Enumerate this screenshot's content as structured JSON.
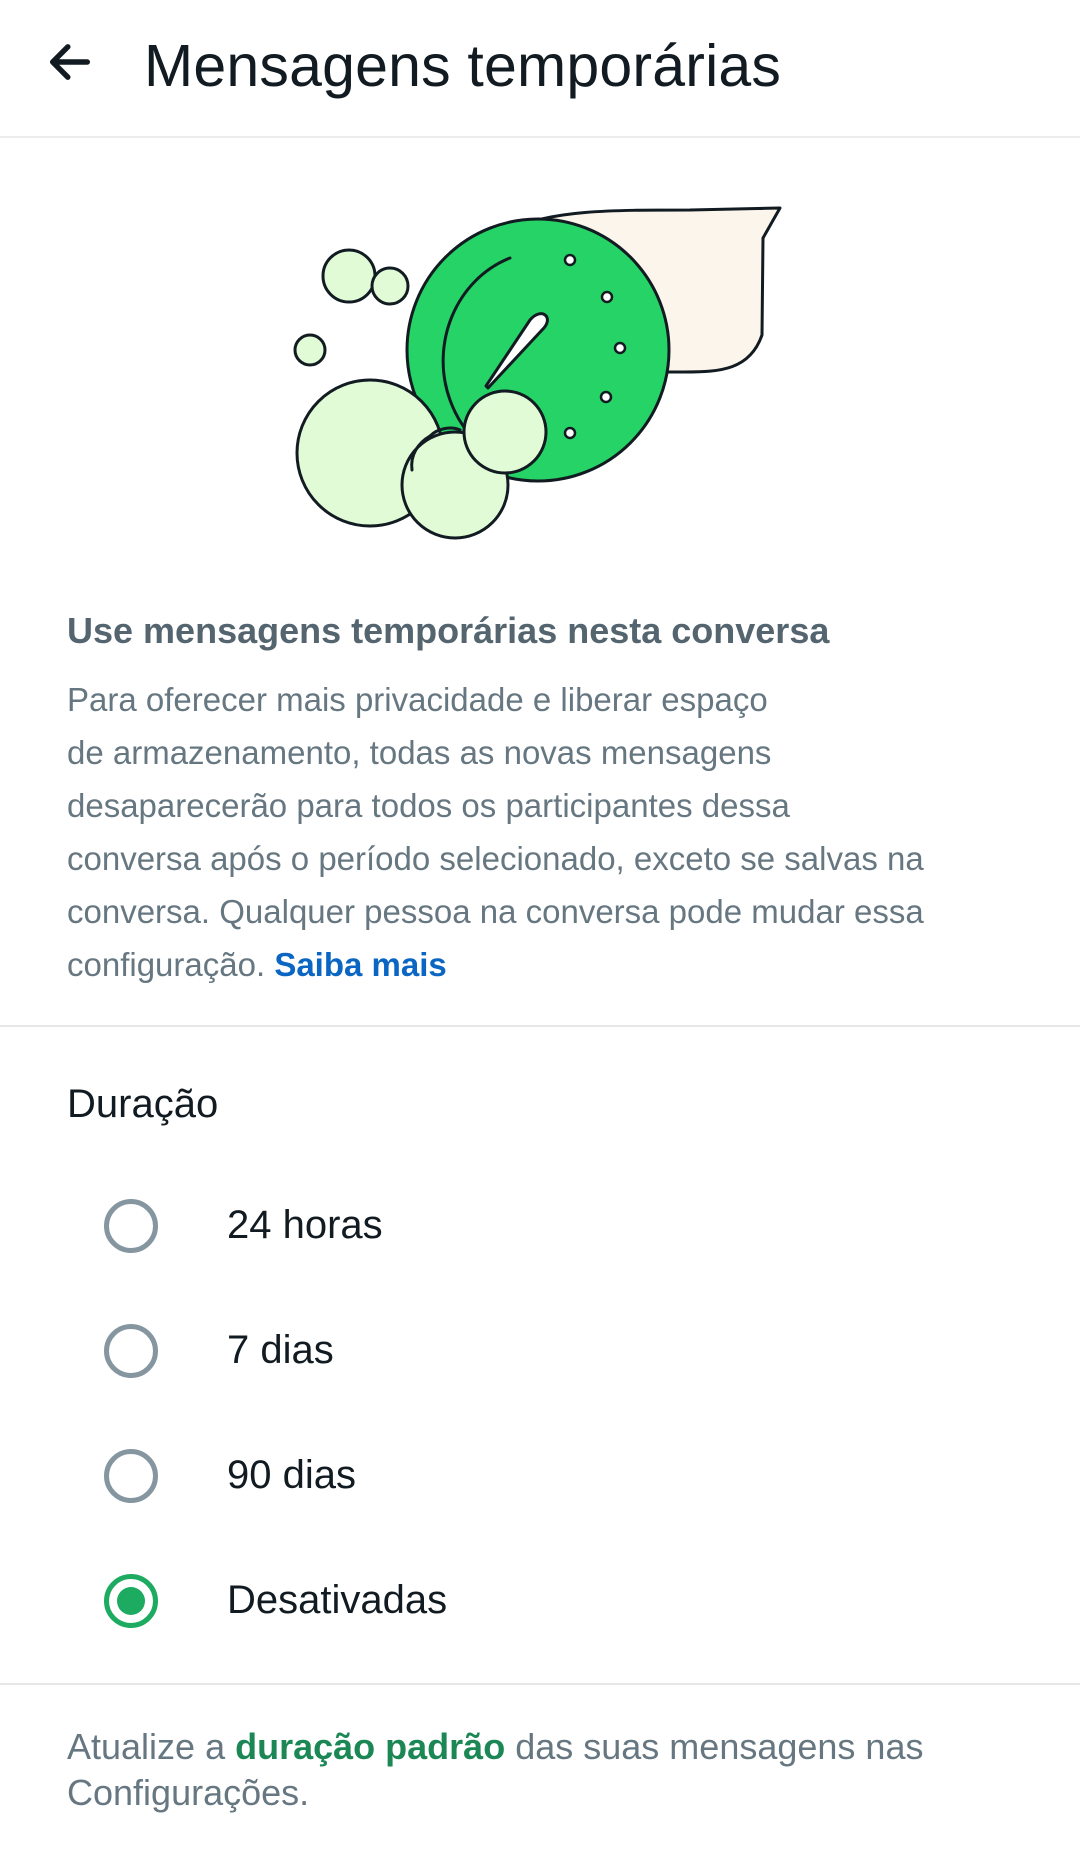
{
  "appbar": {
    "title": "Mensagens temporárias"
  },
  "info": {
    "heading": "Use mensagens temporárias nesta conversa",
    "body_lines": [
      "Para oferecer mais privacidade e liberar espaço",
      "de armazenamento, todas as novas mensagens",
      "desaparecerão para todos os participantes dessa",
      "conversa após o período selecionado, exceto se salvas na",
      "conversa. Qualquer pessoa na conversa pode mudar essa"
    ],
    "body_last_line": "configuração.",
    "learn_more": "Saiba mais"
  },
  "duration": {
    "title": "Duração",
    "options": [
      {
        "label": "24 horas",
        "selected": false
      },
      {
        "label": "7 dias",
        "selected": false
      },
      {
        "label": "90 dias",
        "selected": false
      },
      {
        "label": "Desativadas",
        "selected": true
      }
    ]
  },
  "footer": {
    "prefix": "Atualize a",
    "link": "duração padrão",
    "suffix": "das suas mensagens nas Configurações."
  },
  "colors": {
    "accent_green": "#1daa61",
    "link_blue": "#0a66c2",
    "footer_link_green": "#1b8755",
    "illustration_green": "#25d366",
    "illustration_light_green": "#e2fbd7",
    "illustration_cream": "#fcf5eb"
  },
  "icons": {
    "back": "arrow-left-icon",
    "illustration": "timer-bubbles-illustration"
  }
}
